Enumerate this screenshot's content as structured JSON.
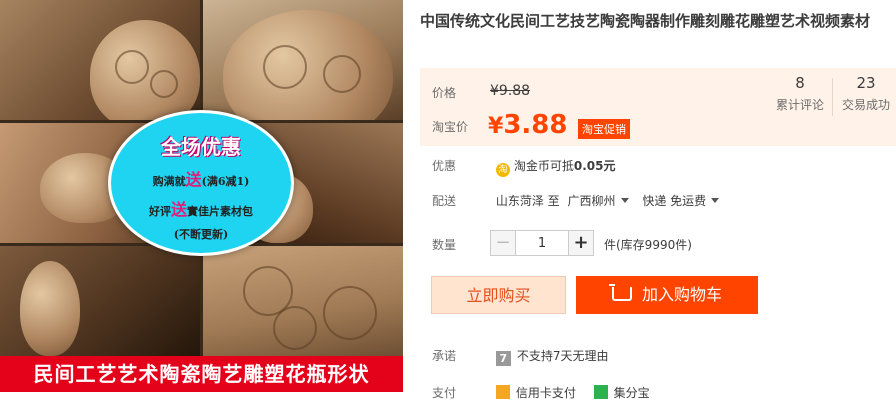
{
  "product": {
    "title": "中国传统文化民间工艺技艺陶瓷陶器制作雕刻雕花雕塑艺术视频素材"
  },
  "gallery": {
    "promo_title": "全场优惠",
    "promo_line1_pre": "购满就",
    "promo_line1_hl": "送",
    "promo_line1_post": "(满6减1)",
    "promo_line2_pre": "好评",
    "promo_line2_hl": "送",
    "promo_line2_post": "實佳片素材包",
    "promo_line3": "(不断更新)",
    "caption": "民间工艺艺术陶瓷陶艺雕塑花瓶形状"
  },
  "price": {
    "label": "价格",
    "original": "¥9.88",
    "taobao_label": "淘宝价",
    "currency": "¥",
    "value": "3.88",
    "promo_tag": "淘宝促销"
  },
  "stats": {
    "reviews_count": "8",
    "reviews_label": "累计评论",
    "sales_count": "23",
    "sales_label": "交易成功"
  },
  "coupon": {
    "label": "优惠",
    "icon": "淘",
    "text_pre": "淘金币可抵",
    "amount": "0.05元"
  },
  "shipping": {
    "label": "配送",
    "from": "山东菏泽 至",
    "to": "广西柳州",
    "method": "快递 免运费"
  },
  "quantity": {
    "label": "数量",
    "minus": "−",
    "value": "1",
    "plus": "+",
    "stock": "件(库存9990件)"
  },
  "actions": {
    "buy_now": "立即购买",
    "add_to_cart": "加入购物车"
  },
  "promise": {
    "label": "承诺",
    "icon": "7",
    "text": "不支持7天无理由"
  },
  "payment": {
    "label": "支付",
    "method1": "信用卡支付",
    "method2": "集分宝"
  }
}
